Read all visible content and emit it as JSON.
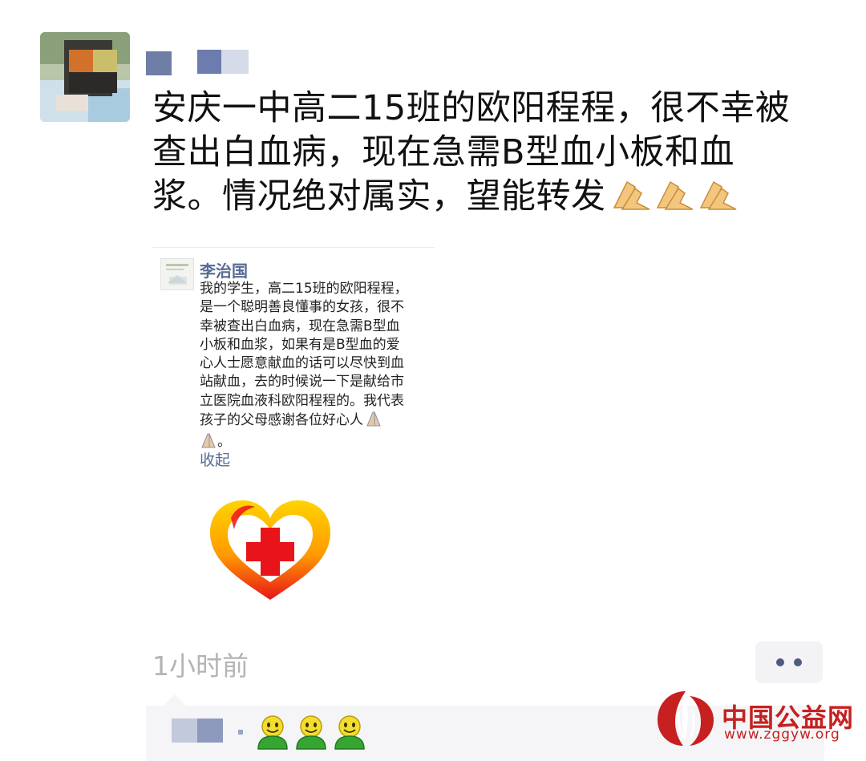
{
  "post": {
    "text_lines": [
      "安庆一中高二15班的欧阳程程，很不幸被",
      "查出白血病，现在急需B型血小板和血",
      "浆。情况绝对属实，望能转发"
    ],
    "emoji": "folded-hands"
  },
  "shared": {
    "author": "李治国",
    "body_lines": [
      "我的学生，高二15班的欧阳程程，",
      "是一个聪明善良懂事的女孩，很不",
      "幸被查出白血病，现在急需B型血",
      "小板和血浆，如果有是B型血的爱",
      "心人士愿意献血的话可以尽快到血",
      "站献血，去的时候说一下是献给市",
      "立医院血液科欧阳程程的。我代表",
      "孩子的父母感谢各位好心人"
    ],
    "body_end": "。",
    "collapse_label": "收起"
  },
  "footer": {
    "timestamp": "1小时前"
  },
  "watermark": {
    "name": "中国公益网",
    "url": "www.zggyw.org"
  },
  "colors": {
    "link_blue": "#576b95",
    "timestamp_gray": "#b4b4b4",
    "watermark_red": "#c62020"
  }
}
